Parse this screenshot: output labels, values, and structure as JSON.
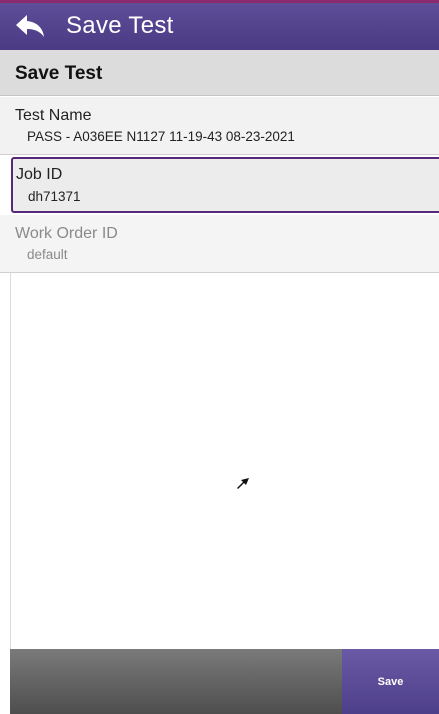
{
  "app_bar": {
    "title": "Save Test",
    "back_icon": "back-arrow-icon",
    "colors": {
      "bar": "#4f3f8a",
      "accent": "#8c2a6e"
    }
  },
  "section": {
    "title": "Save Test"
  },
  "fields": {
    "test_name": {
      "label": "Test Name",
      "value": "PASS - A036EE N1127 11-19-43  08-23-2021"
    },
    "job_id": {
      "label": "Job ID",
      "value": "dh71371"
    },
    "work_order_id": {
      "label": "Work Order ID",
      "value": "default"
    }
  },
  "bottom_bar": {
    "save_label": "Save"
  },
  "colors": {
    "selected_border": "#57287a",
    "disabled_text": "#8a8a8a"
  }
}
